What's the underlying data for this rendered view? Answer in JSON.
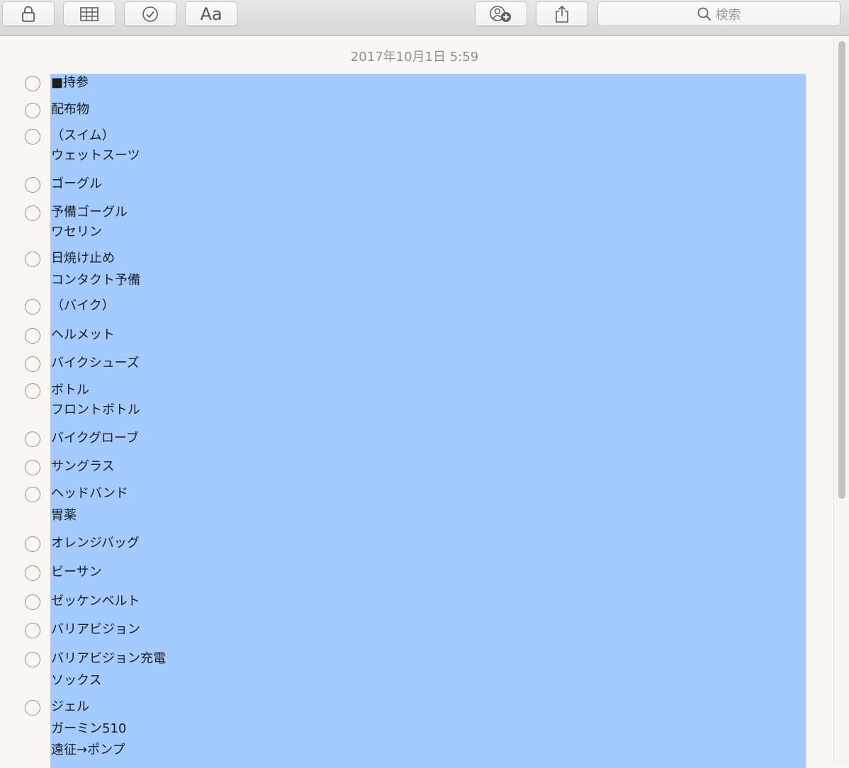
{
  "toolbar": {
    "buttons": [
      {
        "icon": "lock-icon"
      },
      {
        "icon": "table-icon"
      },
      {
        "icon": "checklist-icon"
      },
      {
        "icon": "format-icon",
        "label": "Aa"
      },
      {
        "icon": "add-people-icon"
      },
      {
        "icon": "share-icon"
      }
    ],
    "search_placeholder": "検索"
  },
  "note": {
    "timestamp": "2017年10月1日 5:59",
    "items": [
      {
        "lines": [
          "■持参"
        ]
      },
      {
        "lines": [
          "配布物"
        ]
      },
      {
        "lines": [
          "（スイム）",
          "ウェットスーツ"
        ]
      },
      {
        "lines": [
          "ゴーグル"
        ]
      },
      {
        "lines": [
          "予備ゴーグル",
          "ワセリン"
        ]
      },
      {
        "lines": [
          "日焼け止め",
          "コンタクト予備"
        ]
      },
      {
        "lines": [
          "（バイク）"
        ]
      },
      {
        "lines": [
          "ヘルメット"
        ]
      },
      {
        "lines": [
          "バイクシューズ"
        ]
      },
      {
        "lines": [
          "ボトル",
          "フロントボトル"
        ]
      },
      {
        "lines": [
          "バイクグローブ"
        ]
      },
      {
        "lines": [
          "サングラス"
        ]
      },
      {
        "lines": [
          "ヘッドバンド",
          "胃薬"
        ]
      },
      {
        "lines": [
          "オレンジバッグ"
        ]
      },
      {
        "lines": [
          "ビーサン"
        ]
      },
      {
        "lines": [
          "ゼッケンベルト"
        ]
      },
      {
        "lines": [
          "バリアビジョン"
        ]
      },
      {
        "lines": [
          "バリアビジョン充電",
          "ソックス"
        ]
      },
      {
        "lines": [
          "ジェル",
          "ガーミン510",
          "遠征→ポンプ"
        ]
      }
    ]
  },
  "colors": {
    "selection": "#a3cbfd",
    "text": "#1d1d1d",
    "timestamp": "#8e8e8e"
  }
}
